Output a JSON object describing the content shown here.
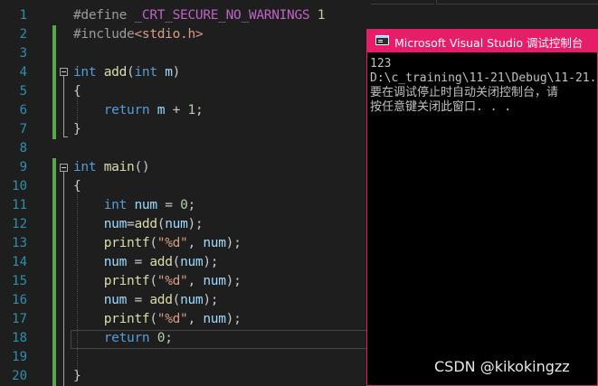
{
  "editor": {
    "line_numbers": [
      "1",
      "2",
      "3",
      "4",
      "5",
      "6",
      "7",
      "8",
      "9",
      "10",
      "11",
      "12",
      "13",
      "14",
      "15",
      "16",
      "17",
      "18",
      "19",
      "20"
    ],
    "lines": [
      {
        "tokens": [
          {
            "t": "#define ",
            "c": "pp"
          },
          {
            "t": "_CRT_SECURE_NO_WARNINGS",
            "c": "mac"
          },
          {
            "t": " 1",
            "c": "num"
          }
        ]
      },
      {
        "tokens": [
          {
            "t": "#include",
            "c": "pp"
          },
          {
            "t": "<stdio.h>",
            "c": "hdr"
          }
        ]
      },
      {
        "tokens": []
      },
      {
        "tokens": [
          {
            "t": "int",
            "c": "kw"
          },
          {
            "t": " ",
            "c": ""
          },
          {
            "t": "add",
            "c": "fn"
          },
          {
            "t": "(",
            "c": "par"
          },
          {
            "t": "int",
            "c": "kw"
          },
          {
            "t": " m",
            "c": "var"
          },
          {
            "t": ")",
            "c": "par"
          }
        ]
      },
      {
        "tokens": [
          {
            "t": "{",
            "c": "par"
          }
        ]
      },
      {
        "tokens": [
          {
            "t": "    ",
            "c": ""
          },
          {
            "t": "return",
            "c": "kw"
          },
          {
            "t": " m ",
            "c": "var"
          },
          {
            "t": "+ ",
            "c": "par"
          },
          {
            "t": "1",
            "c": "num"
          },
          {
            "t": ";",
            "c": "par"
          }
        ]
      },
      {
        "tokens": [
          {
            "t": "}",
            "c": "par"
          }
        ]
      },
      {
        "tokens": []
      },
      {
        "tokens": [
          {
            "t": "int",
            "c": "kw"
          },
          {
            "t": " ",
            "c": ""
          },
          {
            "t": "main",
            "c": "fn"
          },
          {
            "t": "()",
            "c": "par"
          }
        ]
      },
      {
        "tokens": [
          {
            "t": "{",
            "c": "par"
          }
        ]
      },
      {
        "tokens": [
          {
            "t": "    ",
            "c": ""
          },
          {
            "t": "int",
            "c": "kw"
          },
          {
            "t": " num",
            "c": "var"
          },
          {
            "t": " = ",
            "c": "par"
          },
          {
            "t": "0",
            "c": "num"
          },
          {
            "t": ";",
            "c": "par"
          }
        ]
      },
      {
        "tokens": [
          {
            "t": "    ",
            "c": ""
          },
          {
            "t": "num",
            "c": "var"
          },
          {
            "t": "=",
            "c": "par"
          },
          {
            "t": "add",
            "c": "fn"
          },
          {
            "t": "(",
            "c": "par"
          },
          {
            "t": "num",
            "c": "var"
          },
          {
            "t": ");",
            "c": "par"
          }
        ]
      },
      {
        "tokens": [
          {
            "t": "    ",
            "c": ""
          },
          {
            "t": "printf",
            "c": "fn"
          },
          {
            "t": "(",
            "c": "par"
          },
          {
            "t": "\"%d\"",
            "c": "str"
          },
          {
            "t": ", ",
            "c": "par"
          },
          {
            "t": "num",
            "c": "var"
          },
          {
            "t": ");",
            "c": "par"
          }
        ]
      },
      {
        "tokens": [
          {
            "t": "    ",
            "c": ""
          },
          {
            "t": "num",
            "c": "var"
          },
          {
            "t": " = ",
            "c": "par"
          },
          {
            "t": "add",
            "c": "fn"
          },
          {
            "t": "(",
            "c": "par"
          },
          {
            "t": "num",
            "c": "var"
          },
          {
            "t": ");",
            "c": "par"
          }
        ]
      },
      {
        "tokens": [
          {
            "t": "    ",
            "c": ""
          },
          {
            "t": "printf",
            "c": "fn"
          },
          {
            "t": "(",
            "c": "par"
          },
          {
            "t": "\"%d\"",
            "c": "str"
          },
          {
            "t": ", ",
            "c": "par"
          },
          {
            "t": "num",
            "c": "var"
          },
          {
            "t": ");",
            "c": "par"
          }
        ]
      },
      {
        "tokens": [
          {
            "t": "    ",
            "c": ""
          },
          {
            "t": "num",
            "c": "var"
          },
          {
            "t": " = ",
            "c": "par"
          },
          {
            "t": "add",
            "c": "fn"
          },
          {
            "t": "(",
            "c": "par"
          },
          {
            "t": "num",
            "c": "var"
          },
          {
            "t": ");",
            "c": "par"
          }
        ]
      },
      {
        "tokens": [
          {
            "t": "    ",
            "c": ""
          },
          {
            "t": "printf",
            "c": "fn"
          },
          {
            "t": "(",
            "c": "par"
          },
          {
            "t": "\"%d\"",
            "c": "str"
          },
          {
            "t": ", ",
            "c": "par"
          },
          {
            "t": "num",
            "c": "var"
          },
          {
            "t": ");",
            "c": "par"
          }
        ]
      },
      {
        "tokens": [
          {
            "t": "    ",
            "c": ""
          },
          {
            "t": "return",
            "c": "kw"
          },
          {
            "t": " ",
            "c": ""
          },
          {
            "t": "0",
            "c": "num"
          },
          {
            "t": ";",
            "c": "par"
          }
        ]
      },
      {
        "tokens": []
      },
      {
        "tokens": [
          {
            "t": "}",
            "c": "par"
          }
        ]
      }
    ]
  },
  "console": {
    "title": "Microsoft Visual Studio 调试控制台",
    "output_lines": [
      "123",
      "D:\\c_training\\11-21\\Debug\\11-21.",
      "要在调试停止时自动关闭控制台，请",
      "按任意键关闭此窗口. . ."
    ]
  },
  "watermark": "CSDN @kikokingzz",
  "colors": {
    "editor_bg": "#1e1e1e",
    "line_number": "#2b91af",
    "keyword": "#569cd6",
    "function": "#dcdcaa",
    "string": "#d69d85",
    "console_border": "#e81d6a",
    "change_bar": "#57a64a"
  }
}
